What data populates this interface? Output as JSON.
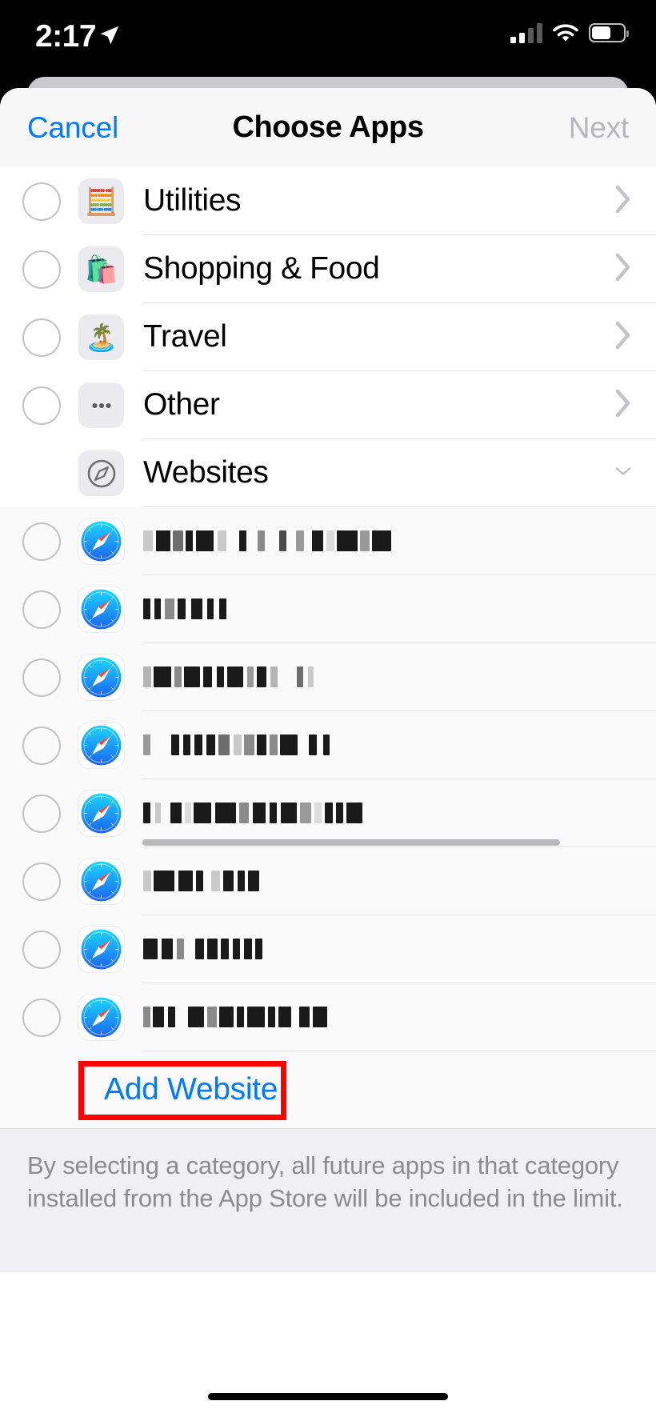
{
  "status_bar": {
    "time": "2:17",
    "location_icon": "location-arrow-icon",
    "signal_icon": "cellular-signal-icon",
    "signal_bars_filled": 2,
    "signal_bars_total": 4,
    "wifi_icon": "wifi-icon",
    "battery_icon": "battery-icon",
    "battery_level_pct": 55
  },
  "navbar": {
    "cancel_label": "Cancel",
    "title": "Choose Apps",
    "next_label": "Next",
    "next_disabled": true
  },
  "colors": {
    "accent_blue": "#007aff",
    "disabled_gray": "#b6b6bb",
    "annotation_red": "#ff0000",
    "row_background": "#ffffff",
    "site_row_background": "#fafafa",
    "footer_background": "#efeff4"
  },
  "categories": [
    {
      "label": "Utilities",
      "icon": "calculator-icon",
      "emoji": "🧮",
      "checkbox": true,
      "accessory": "chevron-right-icon"
    },
    {
      "label": "Shopping & Food",
      "icon": "shopping-bag-icon",
      "emoji": "🛍️",
      "checkbox": true,
      "accessory": "chevron-right-icon"
    },
    {
      "label": "Travel",
      "icon": "island-icon",
      "emoji": "🏝️",
      "checkbox": true,
      "accessory": "chevron-right-icon"
    },
    {
      "label": "Other",
      "icon": "ellipsis-icon",
      "emoji": "•••",
      "checkbox": true,
      "accessory": "chevron-right-icon"
    },
    {
      "label": "Websites",
      "icon": "safari-compass-icon",
      "emoji": "",
      "checkbox": false,
      "accessory": "chevron-down-icon"
    }
  ],
  "websites": [
    {
      "icon": "safari-icon",
      "label": "",
      "redacted": true,
      "blocks": [
        [
          12,
          "#c9c9c9"
        ],
        [
          4,
          "transparent"
        ],
        [
          18,
          "#1a1a1a"
        ],
        [
          3,
          "transparent"
        ],
        [
          13,
          "#6e6e6e"
        ],
        [
          3,
          "transparent"
        ],
        [
          9,
          "#1a1a1a"
        ],
        [
          4,
          "transparent"
        ],
        [
          22,
          "#1a1a1a"
        ],
        [
          5,
          "transparent"
        ],
        [
          11,
          "#c9c9c9"
        ],
        [
          16,
          "transparent"
        ],
        [
          9,
          "#1a1a1a"
        ],
        [
          14,
          "transparent"
        ],
        [
          9,
          "#8a8a8a"
        ],
        [
          18,
          "transparent"
        ],
        [
          9,
          "#4a4a4a"
        ],
        [
          12,
          "transparent"
        ],
        [
          10,
          "#9a9a9a"
        ],
        [
          10,
          "transparent"
        ],
        [
          14,
          "#1a1a1a"
        ],
        [
          4,
          "transparent"
        ],
        [
          10,
          "#dcdcdc"
        ],
        [
          3,
          "transparent"
        ],
        [
          26,
          "#1a1a1a"
        ],
        [
          3,
          "transparent"
        ],
        [
          12,
          "#9a9a9a"
        ],
        [
          3,
          "transparent"
        ],
        [
          24,
          "#1a1a1a"
        ]
      ]
    },
    {
      "icon": "safari-icon",
      "label": "",
      "redacted": true,
      "blocks": [
        [
          9,
          "#1a1a1a"
        ],
        [
          5,
          "transparent"
        ],
        [
          8,
          "#1a1a1a"
        ],
        [
          5,
          "transparent"
        ],
        [
          12,
          "#8a8a8a"
        ],
        [
          4,
          "transparent"
        ],
        [
          10,
          "#1a1a1a"
        ],
        [
          7,
          "transparent"
        ],
        [
          14,
          "#1a1a1a"
        ],
        [
          6,
          "transparent"
        ],
        [
          8,
          "#1a1a1a"
        ],
        [
          7,
          "transparent"
        ],
        [
          9,
          "#1a1a1a"
        ]
      ]
    },
    {
      "icon": "safari-icon",
      "label": "",
      "redacted": true,
      "blocks": [
        [
          10,
          "#b5b5b5"
        ],
        [
          3,
          "transparent"
        ],
        [
          22,
          "#1a1a1a"
        ],
        [
          4,
          "transparent"
        ],
        [
          9,
          "#8a8a8a"
        ],
        [
          3,
          "transparent"
        ],
        [
          20,
          "#1a1a1a"
        ],
        [
          4,
          "transparent"
        ],
        [
          11,
          "#1a1a1a"
        ],
        [
          6,
          "transparent"
        ],
        [
          9,
          "#1a1a1a"
        ],
        [
          4,
          "transparent"
        ],
        [
          20,
          "#1a1a1a"
        ],
        [
          5,
          "transparent"
        ],
        [
          8,
          "#9a9a9a"
        ],
        [
          4,
          "transparent"
        ],
        [
          12,
          "#1a1a1a"
        ],
        [
          5,
          "transparent"
        ],
        [
          9,
          "#b5b5b5"
        ],
        [
          24,
          "transparent"
        ],
        [
          8,
          "#6e6e6e"
        ],
        [
          6,
          "transparent"
        ],
        [
          7,
          "#c9c9c9"
        ]
      ]
    },
    {
      "icon": "safari-icon",
      "label": "",
      "redacted": true,
      "blocks": [
        [
          9,
          "#9a9a9a"
        ],
        [
          26,
          "transparent"
        ],
        [
          10,
          "#1a1a1a"
        ],
        [
          5,
          "transparent"
        ],
        [
          9,
          "#1a1a1a"
        ],
        [
          5,
          "transparent"
        ],
        [
          10,
          "#1a1a1a"
        ],
        [
          5,
          "transparent"
        ],
        [
          11,
          "#1a1a1a"
        ],
        [
          4,
          "transparent"
        ],
        [
          14,
          "#6e6e6e"
        ],
        [
          5,
          "transparent"
        ],
        [
          10,
          "#c9c9c9"
        ],
        [
          3,
          "transparent"
        ],
        [
          13,
          "#8a8a8a"
        ],
        [
          3,
          "transparent"
        ],
        [
          12,
          "#1a1a1a"
        ],
        [
          4,
          "transparent"
        ],
        [
          10,
          "#8a8a8a"
        ],
        [
          3,
          "transparent"
        ],
        [
          22,
          "#1a1a1a"
        ],
        [
          14,
          "transparent"
        ],
        [
          10,
          "#1a1a1a"
        ],
        [
          8,
          "transparent"
        ],
        [
          8,
          "#1a1a1a"
        ]
      ]
    },
    {
      "icon": "safari-icon",
      "label": "",
      "redacted": true,
      "blocks": [
        [
          9,
          "#1a1a1a"
        ],
        [
          6,
          "transparent"
        ],
        [
          7,
          "#c9c9c9"
        ],
        [
          12,
          "transparent"
        ],
        [
          14,
          "#1a1a1a"
        ],
        [
          4,
          "transparent"
        ],
        [
          8,
          "#dcdcdc"
        ],
        [
          3,
          "transparent"
        ],
        [
          22,
          "#1a1a1a"
        ],
        [
          5,
          "transparent"
        ],
        [
          26,
          "#1a1a1a"
        ],
        [
          4,
          "transparent"
        ],
        [
          12,
          "#8a8a8a"
        ],
        [
          5,
          "transparent"
        ],
        [
          16,
          "#1a1a1a"
        ],
        [
          5,
          "transparent"
        ],
        [
          9,
          "#1a1a1a"
        ],
        [
          5,
          "transparent"
        ],
        [
          20,
          "#1a1a1a"
        ],
        [
          4,
          "transparent"
        ],
        [
          14,
          "#9a9a9a"
        ],
        [
          4,
          "transparent"
        ],
        [
          9,
          "#dcdcdc"
        ],
        [
          4,
          "transparent"
        ],
        [
          10,
          "#1a1a1a"
        ],
        [
          4,
          "transparent"
        ],
        [
          9,
          "#1a1a1a"
        ],
        [
          4,
          "transparent"
        ],
        [
          20,
          "#1a1a1a"
        ]
      ],
      "scroll_indicator": true
    },
    {
      "icon": "safari-icon",
      "label": "",
      "redacted": true,
      "blocks": [
        [
          10,
          "#c9c9c9"
        ],
        [
          3,
          "transparent"
        ],
        [
          26,
          "#1a1a1a"
        ],
        [
          5,
          "transparent"
        ],
        [
          18,
          "#1a1a1a"
        ],
        [
          4,
          "transparent"
        ],
        [
          9,
          "#1a1a1a"
        ],
        [
          10,
          "transparent"
        ],
        [
          11,
          "#c9c9c9"
        ],
        [
          4,
          "transparent"
        ],
        [
          13,
          "#1a1a1a"
        ],
        [
          5,
          "transparent"
        ],
        [
          9,
          "#1a1a1a"
        ],
        [
          4,
          "transparent"
        ],
        [
          14,
          "#1a1a1a"
        ]
      ]
    },
    {
      "icon": "safari-icon",
      "label": "",
      "redacted": true,
      "blocks": [
        [
          18,
          "#1a1a1a"
        ],
        [
          5,
          "transparent"
        ],
        [
          14,
          "#1a1a1a"
        ],
        [
          5,
          "transparent"
        ],
        [
          9,
          "#8a8a8a"
        ],
        [
          14,
          "transparent"
        ],
        [
          11,
          "#1a1a1a"
        ],
        [
          4,
          "transparent"
        ],
        [
          13,
          "#1a1a1a"
        ],
        [
          4,
          "transparent"
        ],
        [
          10,
          "#1a1a1a"
        ],
        [
          5,
          "transparent"
        ],
        [
          9,
          "#1a1a1a"
        ],
        [
          5,
          "transparent"
        ],
        [
          10,
          "#1a1a1a"
        ],
        [
          4,
          "transparent"
        ],
        [
          9,
          "#1a1a1a"
        ]
      ]
    },
    {
      "icon": "safari-icon",
      "label": "",
      "redacted": true,
      "blocks": [
        [
          9,
          "#8a8a8a"
        ],
        [
          3,
          "transparent"
        ],
        [
          14,
          "#1a1a1a"
        ],
        [
          5,
          "transparent"
        ],
        [
          9,
          "#1a1a1a"
        ],
        [
          16,
          "transparent"
        ],
        [
          20,
          "#1a1a1a"
        ],
        [
          4,
          "transparent"
        ],
        [
          12,
          "#8a8a8a"
        ],
        [
          3,
          "transparent"
        ],
        [
          18,
          "#1a1a1a"
        ],
        [
          4,
          "transparent"
        ],
        [
          9,
          "#1a1a1a"
        ],
        [
          4,
          "transparent"
        ],
        [
          22,
          "#1a1a1a"
        ],
        [
          4,
          "transparent"
        ],
        [
          9,
          "#1a1a1a"
        ],
        [
          4,
          "transparent"
        ],
        [
          16,
          "#1a1a1a"
        ],
        [
          10,
          "transparent"
        ],
        [
          13,
          "#1a1a1a"
        ],
        [
          4,
          "transparent"
        ],
        [
          18,
          "#1a1a1a"
        ]
      ]
    }
  ],
  "add_website": {
    "label": "Add Website",
    "highlighted": true
  },
  "footer": {
    "text": "By selecting a category, all future apps in that category installed from the App Store will be included in the limit."
  },
  "home_indicator": "home-indicator"
}
